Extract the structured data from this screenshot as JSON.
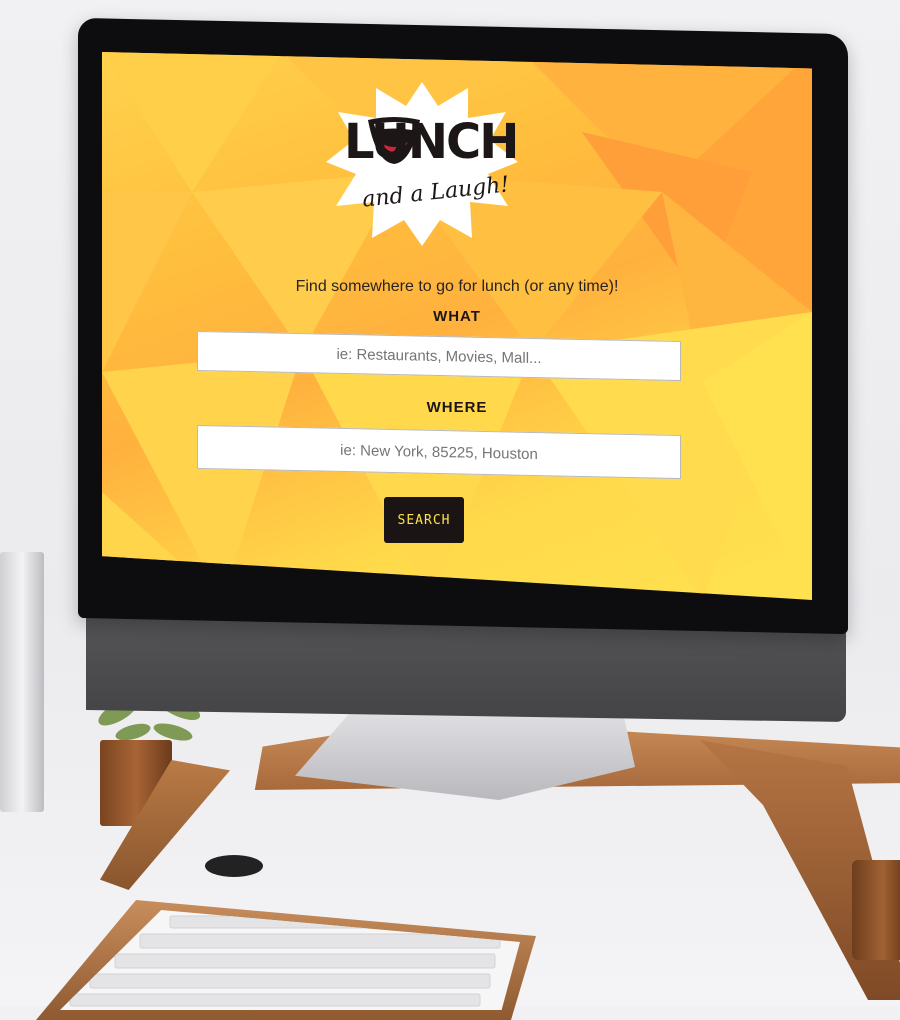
{
  "screen": {
    "logo": {
      "word": "LUNCH",
      "sub": "and a Laugh!"
    },
    "tagline": "Find somewhere to go for lunch (or any time)!",
    "what": {
      "label": "WHAT",
      "placeholder": "ie: Restaurants, Movies, Mall..."
    },
    "where": {
      "label": "WHERE",
      "placeholder": "ie: New York, 85225, Houston"
    },
    "search_label": "SEARCH"
  },
  "colors": {
    "screen_bg": "#ffc23f",
    "button_bg": "#1a1514",
    "button_text": "#ffe04a",
    "mouth_red": "#c8283a"
  }
}
